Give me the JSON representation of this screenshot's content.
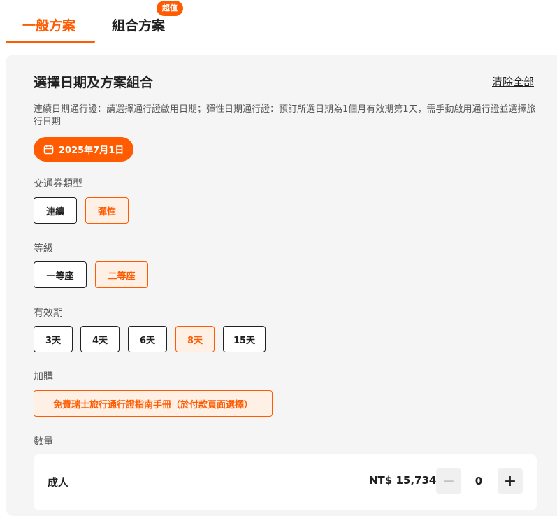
{
  "tabs": {
    "standard": "一般方案",
    "combo": "組合方案",
    "combo_badge": "超值"
  },
  "section": {
    "title": "選擇日期及方案組合",
    "clear_all": "清除全部",
    "description": "連續日期通行證：請選擇通行證啟用日期；彈性日期通行證：預訂所選日期為1個月有效期第1天，需手動啟用通行證並選擇旅行日期"
  },
  "date": {
    "selected": "2025年7月1日",
    "icon": "calendar-icon"
  },
  "pass_type": {
    "label": "交通券類型",
    "options": [
      "連續",
      "彈性"
    ],
    "selected": "彈性"
  },
  "class": {
    "label": "等級",
    "options": [
      "一等座",
      "二等座"
    ],
    "selected": "二等座"
  },
  "validity": {
    "label": "有效期",
    "options": [
      "3天",
      "4天",
      "6天",
      "8天",
      "15天"
    ],
    "selected": "8天"
  },
  "addon": {
    "label": "加購",
    "option": "免費瑞士旅行通行證指南手冊（於付款頁面選擇）"
  },
  "quantity": {
    "label": "數量",
    "rows": [
      {
        "type": "成人",
        "price": "NT$ 15,734",
        "count": "0"
      }
    ]
  },
  "colors": {
    "accent": "#ff5b00",
    "selected_bg": "#fff0e6",
    "panel_bg": "#f5f5f5"
  }
}
